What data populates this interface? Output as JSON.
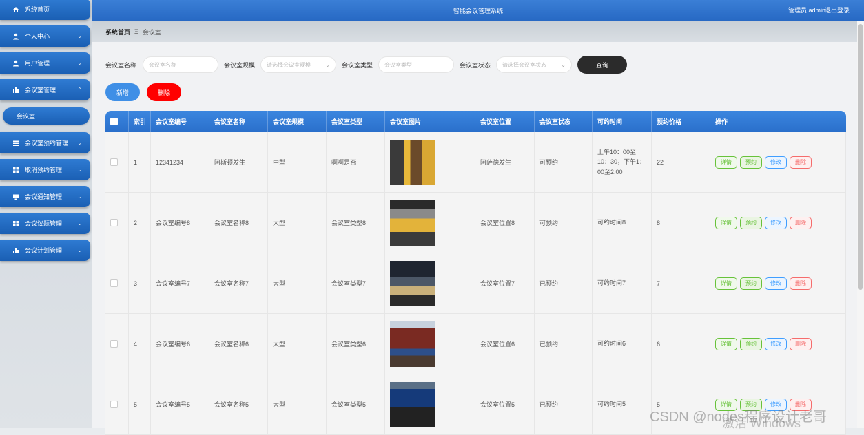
{
  "app": {
    "title": "智能会议管理系统",
    "user": "管理员 admin",
    "logout": "退出登录"
  },
  "sidebar": {
    "items": [
      {
        "label": "系统首页",
        "icon": "home-icon"
      },
      {
        "label": "个人中心",
        "icon": "user-icon"
      },
      {
        "label": "用户管理",
        "icon": "user-icon"
      },
      {
        "label": "会议室管理",
        "icon": "chart-icon"
      },
      {
        "label": "会议室预约管理",
        "icon": "list-icon"
      },
      {
        "label": "取消预约管理",
        "icon": "grid-icon"
      },
      {
        "label": "会议通知管理",
        "icon": "monitor-icon"
      },
      {
        "label": "会议议题管理",
        "icon": "grid-icon"
      },
      {
        "label": "会议计划管理",
        "icon": "bar-chart-icon"
      }
    ],
    "sub_item": "会议室"
  },
  "breadcrumb": {
    "home": "系统首页",
    "sep": "Ξ",
    "current": "会议室"
  },
  "search": {
    "name_label": "会议室名称",
    "name_placeholder": "会议室名称",
    "scale_label": "会议室规模",
    "scale_placeholder": "请选择会议室规模",
    "type_label": "会议室类型",
    "type_placeholder": "会议室类型",
    "status_label": "会议室状态",
    "status_placeholder": "请选择会议室状态",
    "query": "查询"
  },
  "actions": {
    "add": "新增",
    "delete": "删除"
  },
  "table": {
    "headers": [
      "索引",
      "会议室编号",
      "会议室名称",
      "会议室规模",
      "会议室类型",
      "会议室图片",
      "会议室位置",
      "会议室状态",
      "可约时间",
      "预约价格",
      "操作"
    ],
    "rows": [
      {
        "index": "1",
        "code": "12341234",
        "name": "阿斯顿发生",
        "scale": "中型",
        "type": "啊啊是否",
        "location": "阿萨德发生",
        "status": "可预约",
        "time": "上午10：00至10：30，下午1：00至2:00",
        "price": "22"
      },
      {
        "index": "2",
        "code": "会议室编号8",
        "name": "会议室名称8",
        "scale": "大型",
        "type": "会议室类型8",
        "location": "会议室位置8",
        "status": "可预约",
        "time": "可约时间8",
        "price": "8"
      },
      {
        "index": "3",
        "code": "会议室编号7",
        "name": "会议室名称7",
        "scale": "大型",
        "type": "会议室类型7",
        "location": "会议室位置7",
        "status": "已预约",
        "time": "可约时间7",
        "price": "7"
      },
      {
        "index": "4",
        "code": "会议室编号6",
        "name": "会议室名称6",
        "scale": "大型",
        "type": "会议室类型6",
        "location": "会议室位置6",
        "status": "已预约",
        "time": "可约时间6",
        "price": "6"
      },
      {
        "index": "5",
        "code": "会议室编号5",
        "name": "会议室名称5",
        "scale": "大型",
        "type": "会议室类型5",
        "location": "会议室位置5",
        "status": "已预约",
        "time": "可约时间5",
        "price": "5"
      }
    ],
    "ops": {
      "detail": "详情",
      "book": "预约",
      "edit": "修改",
      "delete": "删除"
    }
  },
  "watermarks": {
    "csdn": "CSDN @nodes程序设计老哥",
    "windows": "激活 Windows"
  },
  "colors": {
    "primary": "#2a6fcb",
    "danger": "#ff0000",
    "dark": "#2b2b2b"
  }
}
